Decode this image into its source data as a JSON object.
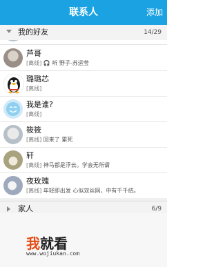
{
  "header": {
    "title": "联系人",
    "add_label": "添加"
  },
  "groups": [
    {
      "name": "我的好友",
      "count": "14/29",
      "expanded": true
    },
    {
      "name": "家人",
      "count": "6/9",
      "expanded": false
    }
  ],
  "contacts": [
    {
      "name": "芦哥",
      "status": "[离线]",
      "signature": "听 野子-苏运莹",
      "has_music": true
    },
    {
      "name": "璐璐芯",
      "status": "[离线]",
      "signature": ""
    },
    {
      "name": "我是谁?",
      "status": "[离线]",
      "signature": ""
    },
    {
      "name": "筱筱",
      "status": "[离线]",
      "signature": "回来了 累死"
    },
    {
      "name": "轩",
      "status": "[离线]",
      "signature": "神马都是浮云。学会无所谓"
    },
    {
      "name": "夜玫瑰",
      "status": "[离线]",
      "signature": "年轻即出发 心似双丝网，中有千千结。"
    }
  ],
  "watermark": {
    "text_highlight": "我",
    "text_rest": "就看",
    "url": "www.wojiukan.com"
  },
  "colors": {
    "titlebar": "#1ba2e2",
    "watermark_accent": "#e34b13"
  }
}
